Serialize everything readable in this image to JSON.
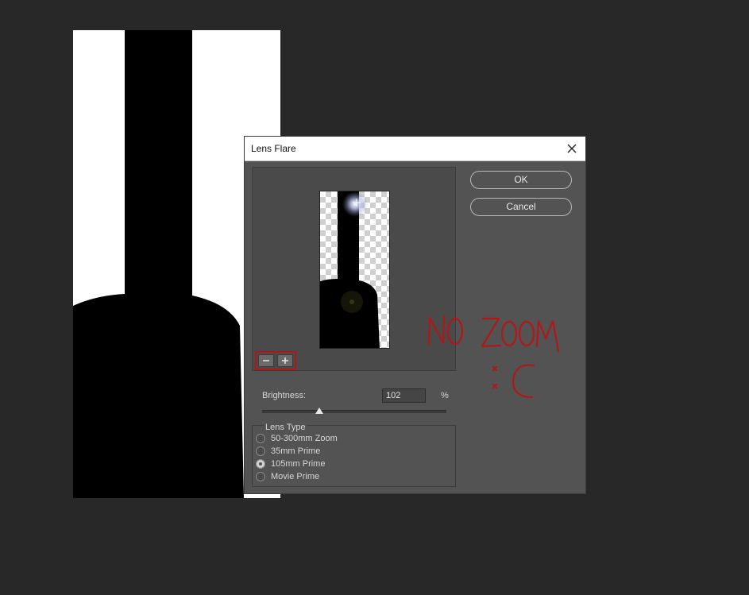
{
  "dialog": {
    "title": "Lens Flare",
    "ok_label": "OK",
    "cancel_label": "Cancel",
    "close_icon": "close-icon"
  },
  "zoom": {
    "zoom_out_icon": "minus-icon",
    "zoom_in_icon": "plus-icon"
  },
  "brightness": {
    "label": "Brightness:",
    "value": "102",
    "unit": "%",
    "level_fraction": 0.31
  },
  "lens_type": {
    "legend": "Lens Type",
    "options": [
      {
        "label": "50-300mm Zoom",
        "selected": false
      },
      {
        "label": "35mm Prime",
        "selected": false
      },
      {
        "label": "105mm Prime",
        "selected": true
      },
      {
        "label": "Movie Prime",
        "selected": false
      }
    ]
  },
  "annotation": {
    "text": "NO ZOOM",
    "face": ":C",
    "color": "#b01818"
  },
  "colors": {
    "app_background": "#282828",
    "dialog_background": "#535353",
    "titlebar": "#ffffff"
  }
}
